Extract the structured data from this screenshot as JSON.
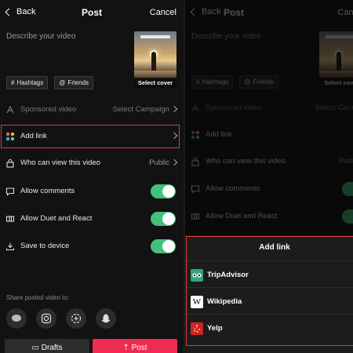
{
  "left": {
    "header": {
      "back_label": "Back",
      "title": "Post",
      "cancel_label": "Cancel"
    },
    "description_placeholder": "Describe your video",
    "cover_label": "Select cover",
    "chips": [
      {
        "label": "Hashtags",
        "icon": "hash-icon"
      },
      {
        "label": "Friends",
        "icon": "at-icon"
      }
    ],
    "rows": {
      "sponsored": {
        "label": "Sponsored video",
        "value": "Select Campaign"
      },
      "add_link": {
        "label": "Add link"
      },
      "who_can_view": {
        "label": "Who can view this video",
        "value": "Public"
      },
      "allow_comments": {
        "label": "Allow comments",
        "on": true
      },
      "allow_duet": {
        "label": "Allow Duet and React",
        "on": true
      },
      "save_device": {
        "label": "Save to device",
        "on": true
      }
    },
    "share_label": "Share posted video to:",
    "share_targets": [
      "messages-icon",
      "instagram-icon",
      "add-story-icon",
      "snapchat-icon"
    ],
    "drafts_label": "Drafts",
    "post_label": "Post"
  },
  "right": {
    "header": {
      "back_label": "Back",
      "title": "Post",
      "cancel_label": "Canc"
    },
    "description_placeholder": "Describe your video",
    "cover_label": "Select cove",
    "chips": [
      {
        "label": "Hashtags"
      },
      {
        "label": "Friends"
      }
    ],
    "rows": {
      "sponsored": {
        "label": "Sponsored video",
        "value": "Select Campaign"
      },
      "add_link": {
        "label": "Add link"
      },
      "who_can_view": {
        "label": "Who can view this video",
        "value": "Public"
      },
      "allow_comments": {
        "label": "Allow comments"
      },
      "allow_duet": {
        "label": "Allow Duet and React"
      },
      "save_device": {
        "label": "Save to device"
      }
    },
    "sheet": {
      "title": "Add link",
      "options": [
        {
          "label": "TripAdvisor",
          "icon": "tripadvisor-icon",
          "color": "#34a57a"
        },
        {
          "label": "Wikipedia",
          "icon": "wikipedia-icon",
          "color": "#ffffff"
        },
        {
          "label": "Yelp",
          "icon": "yelp-icon",
          "color": "#d32323"
        }
      ]
    }
  },
  "colors": {
    "toggle_on": "#42c17a",
    "post_button": "#ef2b52",
    "highlight": "#e23a3a"
  }
}
